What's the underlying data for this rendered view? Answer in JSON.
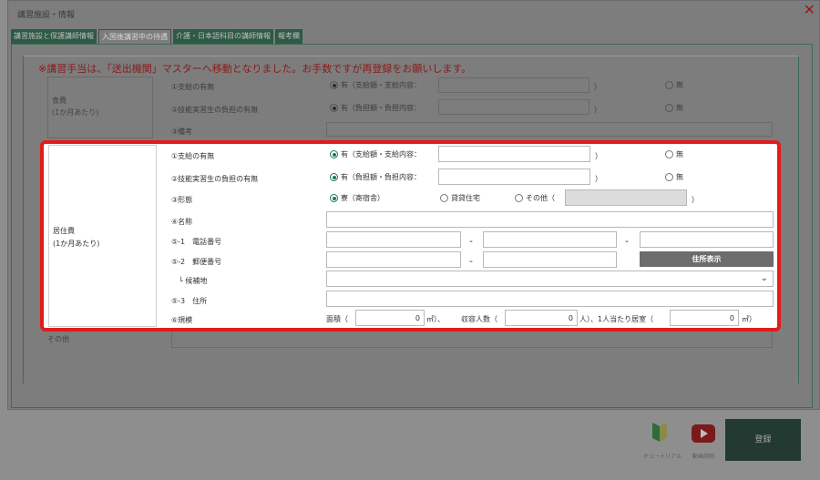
{
  "window": {
    "title": "講習施設・情報",
    "close": "✕"
  },
  "tabs": [
    {
      "label": "講習施設と保護講師情報"
    },
    {
      "label": "入国後講習中の待遇"
    },
    {
      "label": "介護・日本語科目の講師情報"
    },
    {
      "label": "報考欄"
    }
  ],
  "notice": "※講習手当は、「送出機関」マスターへ移動となりました。お手数ですが再登録をお願いします。",
  "food": {
    "label": "食費",
    "sublabel": "(1か月あたり)",
    "q1": "①支給の有無",
    "q2": "②技能実習生の負担の有無",
    "q3": "③備考",
    "yes_pay": "有（支給額・支給内容：",
    "yes_burden": "有（負担額・負担内容：",
    "close_paren": "）",
    "no": "無"
  },
  "housing": {
    "label": "居住費",
    "sublabel": "(1か月あたり)",
    "q1": "①支給の有無",
    "q2": "②技能実習生の負担の有無",
    "q3": "③形態",
    "q4": "④名称",
    "q5_1": "⑤-1　電話番号",
    "q5_2": "⑤-2　郵便番号",
    "candidate": "└ 候補地",
    "q5_3": "⑤-3　住所",
    "q6": "⑥規模",
    "yes_pay": "有（支給額・支給内容：",
    "yes_burden": "有（負担額・負担内容：",
    "close_paren": "）",
    "no": "無",
    "form_dorm": "寮（寄宿舎）",
    "form_rental": "貸貸住宅",
    "form_other": "その他（",
    "dash": "-",
    "address_button": "住所表示",
    "area_label": "面積（",
    "area_value": "0",
    "area_unit": "㎡）、",
    "capacity_label": "収容人数（",
    "capacity_value": "0",
    "capacity_unit": "人）、1人当たり居室（",
    "per_room_value": "0",
    "per_room_unit": "㎡）"
  },
  "other": {
    "label": "その他"
  },
  "footer": {
    "tutorial": "チュートリアル",
    "video": "動画説明",
    "register": "登録"
  }
}
